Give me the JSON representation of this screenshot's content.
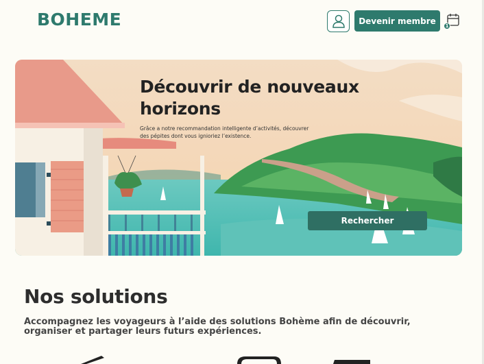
{
  "header": {
    "logo": "BOHEME",
    "member_button": "Devenir membre",
    "calendar_badge": "1",
    "icons": [
      "user-icon",
      "calendar-icon"
    ]
  },
  "hero": {
    "title": "Découvrir de nouveaux horizons",
    "subtitle": "Grâce a notre recommandation intelligente d’activités, découvrer des pépites dont vous ignioriez l’existence.",
    "search_button": "Rechercher"
  },
  "solutions": {
    "title": "Nos solutions",
    "text": "Accompagnez les voyageurs à l’aide des solutions Bohème afin de découvrir, organiser et partager leurs futurs expériences."
  },
  "colors": {
    "brand": "#2e7a6d",
    "background": "#fdfcf6",
    "button": "#2f6f63"
  }
}
